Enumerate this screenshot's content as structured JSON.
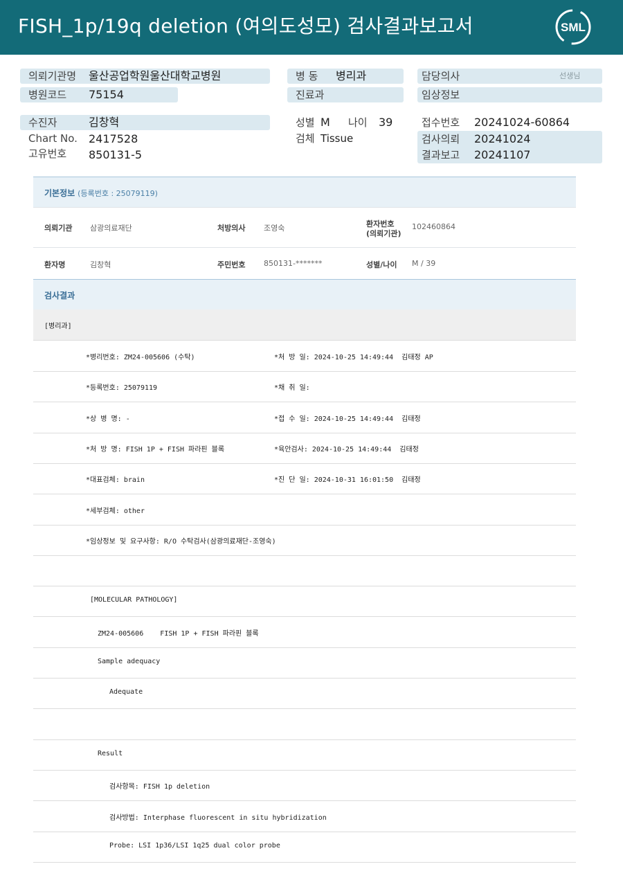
{
  "header": {
    "title": "FISH_1p/19q  deletion (여의도성모) 검사결과보고서",
    "logo_text": "SML"
  },
  "summary": {
    "hospital_label": "의뢰기관명",
    "hospital_value": "울산공업학원울산대학교병원",
    "ward_label": "병  동",
    "ward_value": "병리과",
    "doctor_label": "담당의사",
    "doctor_suffix": "선생님",
    "hospcode_label": "병원코드",
    "hospcode_value": "75154",
    "dept_label": "진료과",
    "clinical_label": "임상정보",
    "patient_label": "수진자",
    "patient_value": "김창혁",
    "sex_label": "성별",
    "sex_value": "M",
    "age_label": "나이",
    "age_value": "39",
    "reception_label": "접수번호",
    "reception_value": "20241024-60864",
    "chart_label": "Chart No.",
    "chart_value": "2417528",
    "specimen_label": "검체",
    "specimen_value": "Tissue",
    "request_label": "검사의뢰",
    "request_value": "20241024",
    "uid_label": "고유번호",
    "uid_value": "850131-5",
    "report_label": "결과보고",
    "report_value": "20241107"
  },
  "basic": {
    "title": "기본정보",
    "subtitle": "(등록번호 : 25079119)",
    "fields": {
      "inst_k": "의뢰기관",
      "inst_v": "삼광의료재단",
      "presc_k": "처방의사",
      "presc_v": "조영숙",
      "pno_k1": "환자번호",
      "pno_k2": "(의뢰기관)",
      "pno_v": "102460864",
      "name_k": "환자명",
      "name_v": "김창혁",
      "rrn_k": "주민번호",
      "rrn_v": "850131-*******",
      "sexage_k": "성별/나이",
      "sexage_v": "M / 39"
    }
  },
  "results": {
    "title": "검사결과",
    "dept_line": "[병리과]",
    "lines": [
      {
        "left": "*병리번호: ZM24-005606 (수탁)",
        "right": "*처 방 일: 2024-10-25 14:49:44  김태정 AP"
      },
      {
        "left": "*등록번호: 25079119",
        "right": "*채 취 일:"
      },
      {
        "left": "*상 병 명: -",
        "right": "*접 수 일: 2024-10-25 14:49:44  김태정"
      },
      {
        "left": "*처 방 명: FISH 1P + FISH 파라핀 블록",
        "right": "*육안검사: 2024-10-25 14:49:44  김태정"
      },
      {
        "left": "*대표검체: brain",
        "right": "*진 단 일: 2024-10-31 16:01:50  김태정"
      },
      {
        "left": "*세부검체: other",
        "right": ""
      },
      {
        "left": "*임상정보 및 요구사항: R/O 수탁검사(삼광의료재단-조영숙)",
        "right": ""
      },
      {
        "left": "",
        "right": ""
      },
      {
        "left": "[MOLECULAR PATHOLOGY]",
        "right": ""
      },
      {
        "left": "ZM24-005606    FISH 1P + FISH 파라핀 블록",
        "right": ""
      },
      {
        "left": "Sample adequacy",
        "right": ""
      },
      {
        "left": "Adequate",
        "right": ""
      },
      {
        "left": "",
        "right": ""
      },
      {
        "left": "Result",
        "right": ""
      },
      {
        "left": "검사항목: FISH 1p deletion",
        "right": ""
      },
      {
        "left": "검사방법: Interphase fluorescent in situ hybridization",
        "right": ""
      },
      {
        "left": "Probe: LSI 1p36/LSI 1q25 dual color probe",
        "right": ""
      }
    ]
  },
  "colors": {
    "header_bg": "#136b78",
    "pill_bg": "#dbe9f0",
    "section_bg": "#e8f1f7"
  }
}
